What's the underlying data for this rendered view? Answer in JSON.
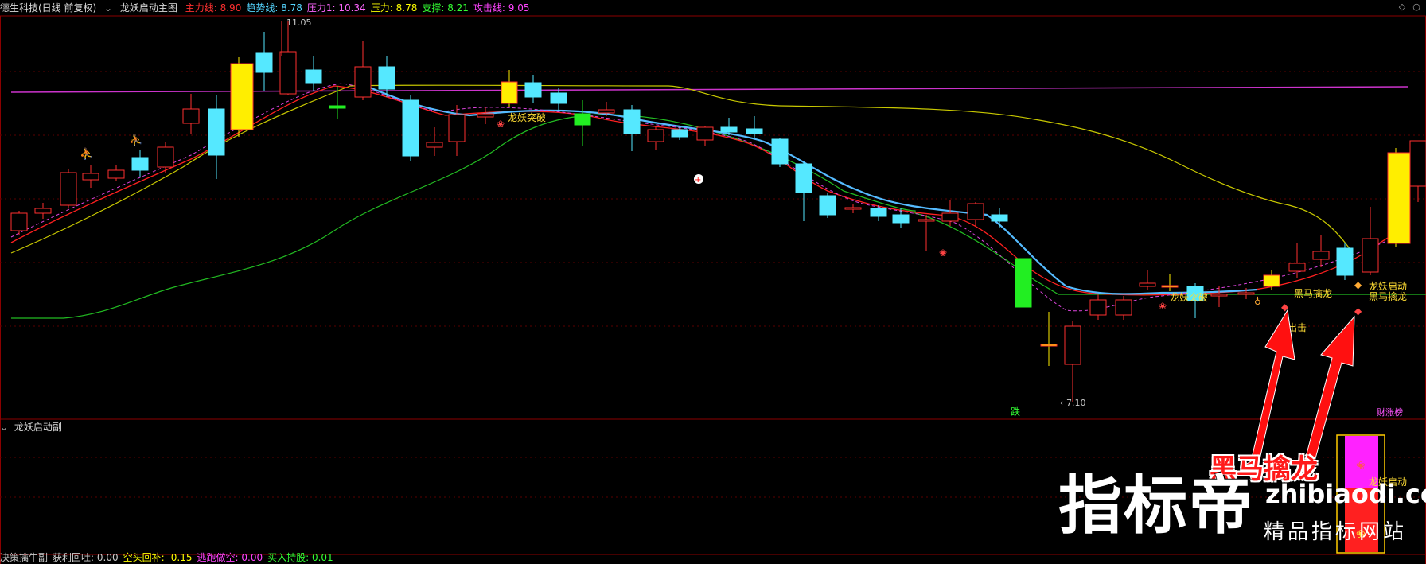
{
  "header": {
    "stock_label": "德生科技(日线 前复权)",
    "indicator_name": "龙妖启动主图",
    "metrics": [
      {
        "label": "主力线:",
        "value": "8.90",
        "color": "#ff3030"
      },
      {
        "label": "趋势线:",
        "value": "8.78",
        "color": "#55d5ff"
      },
      {
        "label": "压力1:",
        "value": "10.34",
        "color": "#ff66ff"
      },
      {
        "label": "压力:",
        "value": "8.78",
        "color": "#ffff00"
      },
      {
        "label": "支撑:",
        "value": "8.21",
        "color": "#33ff33"
      },
      {
        "label": "攻击线:",
        "value": "9.05",
        "color": "#ff44ff"
      }
    ]
  },
  "chart_data": {
    "type": "candlestick",
    "price_high_label": "11.05",
    "price_low_label": "7.10",
    "annotations": {
      "breakout_1": "龙妖突破",
      "breakout_2": "龙妖突破",
      "dark_horse_1": "黑马擒龙",
      "dark_horse_2": "黑马擒龙",
      "launch": "龙妖启动",
      "strike": "出击",
      "drop": "跌",
      "caizhang": "财涨榜"
    }
  },
  "sub_panel": {
    "title": "龙妖启动副",
    "bar_label": "龙妖启动"
  },
  "footer": {
    "items": [
      {
        "label": "决策擒牛副",
        "color": "#cccccc"
      },
      {
        "label": "获利回吐:",
        "value": "0.00",
        "color": "#cccccc"
      },
      {
        "label": "空头回补:",
        "value": "-0.15",
        "color": "#ffff00"
      },
      {
        "label": "逃跑做空:",
        "value": "0.00",
        "color": "#ff44ff"
      },
      {
        "label": "买入持股:",
        "value": "0.01",
        "color": "#33ff33"
      }
    ]
  },
  "watermark": {
    "big": "指标帝",
    "url": "zhibiaodi.com",
    "sub": "精品指标网站",
    "callout": "黑马擒龙"
  },
  "colors": {
    "up": "#ff3030",
    "down": "#55e8ff",
    "ma_main": "#ff3030",
    "ma_trend": "#55bbff",
    "support": "#22cc22",
    "pressure": "#cccc00",
    "attack": "#ff55ff",
    "frame": "#8b0000"
  }
}
